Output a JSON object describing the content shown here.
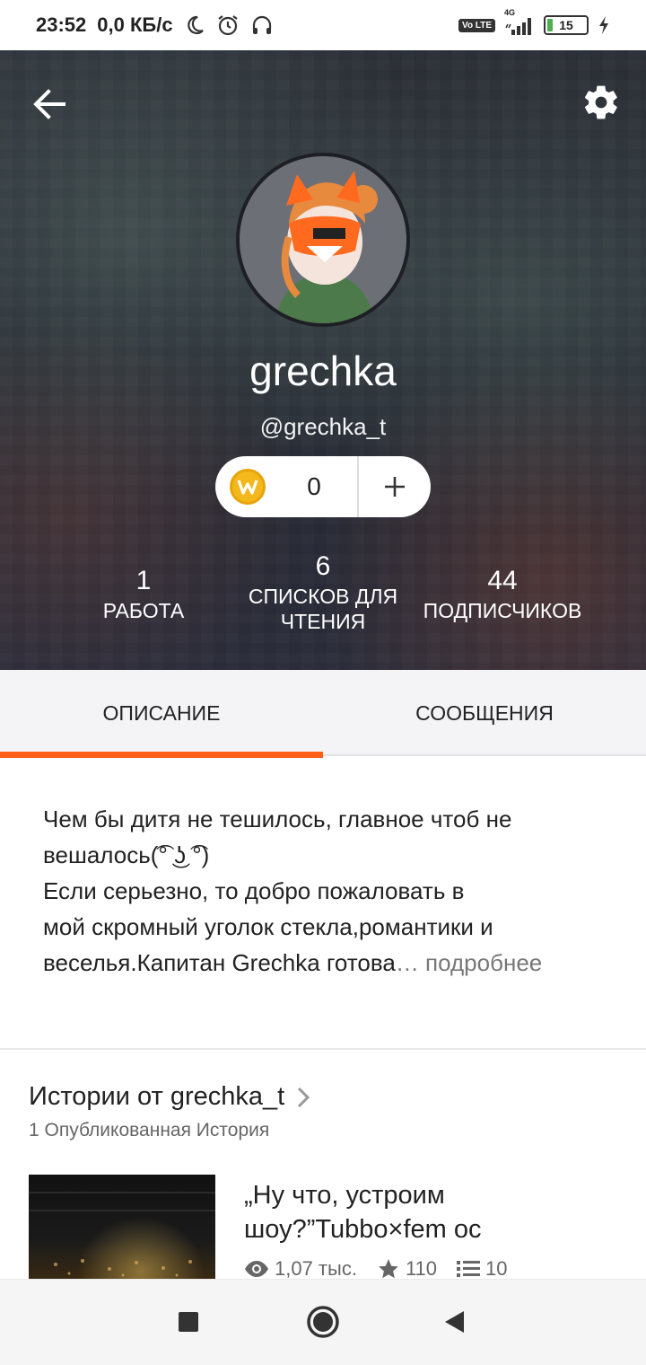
{
  "status_bar": {
    "time": "23:52",
    "net_speed": "0,0 КБ/с",
    "volte_label": "Vo LTE",
    "signal_label": "4G",
    "battery": "15"
  },
  "profile": {
    "username": "grechka",
    "handle": "@grechka_t",
    "coins": "0"
  },
  "stats": [
    {
      "value": "1",
      "label": "РАБОТА"
    },
    {
      "value": "6",
      "label": "СПИСКОВ ДЛЯ ЧТЕНИЯ"
    },
    {
      "value": "44",
      "label": "ПОДПИСЧИКОВ"
    }
  ],
  "tabs": {
    "description": "ОПИСАНИЕ",
    "messages": "СООБЩЕНИЯ",
    "active": "description"
  },
  "description": {
    "line1": "Чем бы дитя не тешилось, главное чтоб не",
    "line2": "вешалось(͡° ͜ʖ ͡°)",
    "line3": "Если серьезно, то добро пожаловать в",
    "line4": "мой скромный уголок стекла,романтики и",
    "line5": "веселья.Капитан Grechka готова",
    "more": "… подробнее"
  },
  "stories": {
    "title": "Истории от grechka_t",
    "subtitle": "1 Опубликованная История",
    "item": {
      "title": "„Ну что, устроим шоу?”Tubbo×fem oc",
      "views": "1,07 тыс.",
      "votes": "110",
      "parts": "10"
    }
  },
  "colors": {
    "accent": "#ff5e16",
    "coin": "#f3b81c"
  }
}
